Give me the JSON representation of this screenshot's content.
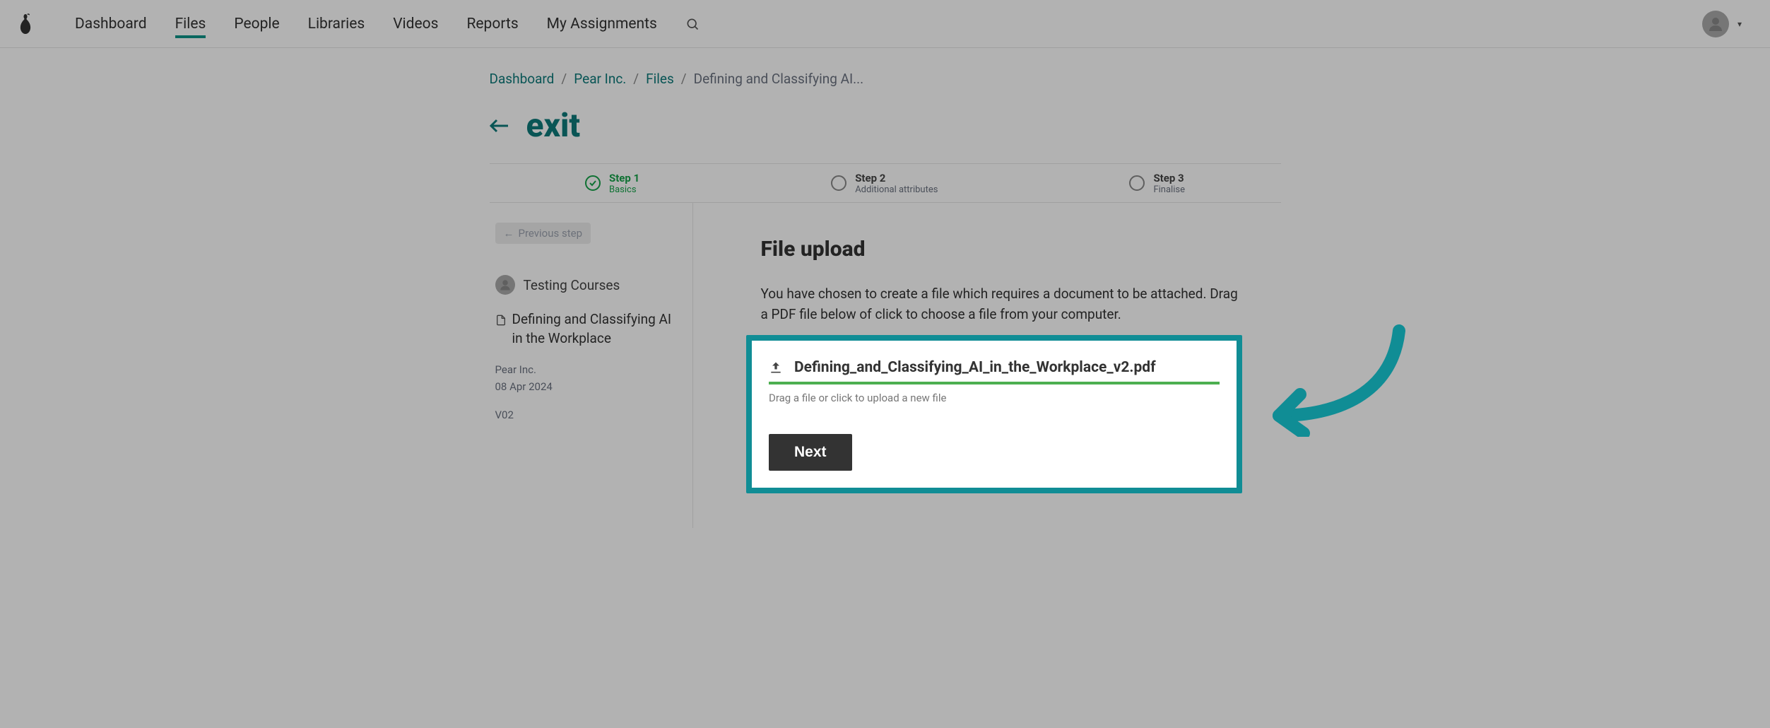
{
  "nav": {
    "items": [
      "Dashboard",
      "Files",
      "People",
      "Libraries",
      "Videos",
      "Reports",
      "My Assignments"
    ],
    "active_index": 1
  },
  "breadcrumbs": {
    "dashboard": "Dashboard",
    "org": "Pear Inc.",
    "files": "Files",
    "current": "Defining and Classifying AI..."
  },
  "exit_label": "exit",
  "steps": {
    "s1": {
      "title": "Step 1",
      "sub": "Basics"
    },
    "s2": {
      "title": "Step 2",
      "sub": "Additional attributes"
    },
    "s3": {
      "title": "Step 3",
      "sub": "Finalise"
    }
  },
  "sidebar": {
    "prev_label": "Previous step",
    "author": "Testing Courses",
    "file_title": "Defining and Classifying AI in the Workplace",
    "org": "Pear Inc.",
    "date": "08 Apr 2024",
    "version": "V02"
  },
  "main": {
    "heading": "File upload",
    "description": "You have chosen to create a file which requires a document to be attached. Drag a PDF file below of click to choose a file from your computer.",
    "uploaded_filename": "Defining_and_Classifying_AI_in_the_Workplace_v2.pdf",
    "drag_hint": "Drag a file or click to upload a new file",
    "next_label": "Next"
  },
  "colors": {
    "teal": "#108d95",
    "link": "#0d7a7a",
    "green": "#16a34a"
  }
}
